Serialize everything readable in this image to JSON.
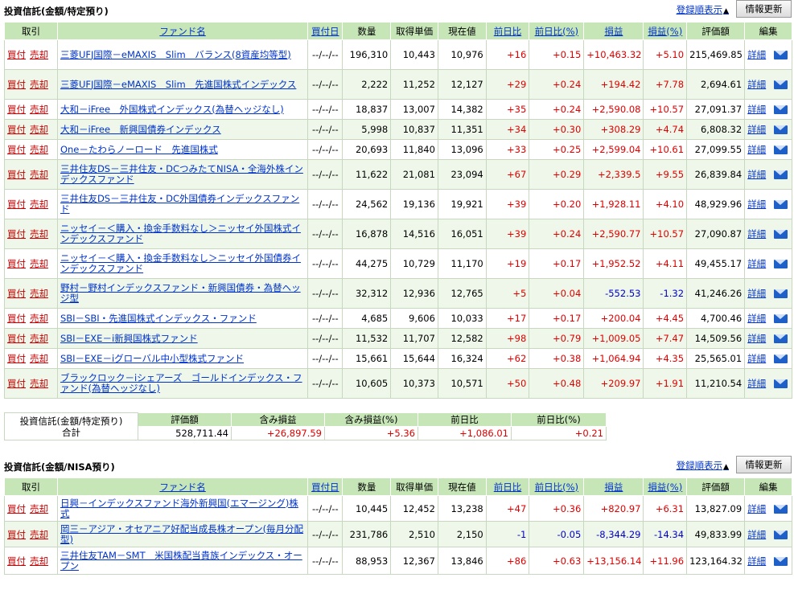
{
  "specific": {
    "title": "投資信託(金額/特定預り)",
    "order_link": "登録順表示",
    "refresh": "情報更新",
    "headers": {
      "trade": "取引",
      "fund": "ファンド名",
      "buy_date": "買付日",
      "qty": "数量",
      "cost": "取得単価",
      "price": "現在値",
      "chg": "前日比",
      "chg_pct": "前日比(%)",
      "pl": "損益",
      "pl_pct": "損益(%)",
      "value": "評価額",
      "edit": "編集"
    },
    "buy_label": "買付",
    "sell_label": "売却",
    "detail_label": "詳細",
    "rows": [
      {
        "name": "三菱UFJ国際－eMAXIS　Slim　バランス(8資産均等型)",
        "date": "--/--/--",
        "qty": "196,310",
        "cost": "10,443",
        "price": "10,976",
        "chg": "+16",
        "chg_pct": "+0.15",
        "pl": "+10,463.32",
        "pl_pct": "+5.10",
        "value": "215,469.85"
      },
      {
        "name": "三菱UFJ国際－eMAXIS　Slim　先進国株式インデックス",
        "date": "--/--/--",
        "qty": "2,222",
        "cost": "11,252",
        "price": "12,127",
        "chg": "+29",
        "chg_pct": "+0.24",
        "pl": "+194.42",
        "pl_pct": "+7.78",
        "value": "2,694.61"
      },
      {
        "name": "大和－iFree　外国株式インデックス(為替ヘッジなし)",
        "date": "--/--/--",
        "qty": "18,837",
        "cost": "13,007",
        "price": "14,382",
        "chg": "+35",
        "chg_pct": "+0.24",
        "pl": "+2,590.08",
        "pl_pct": "+10.57",
        "value": "27,091.37"
      },
      {
        "name": "大和－iFree　新興国債券インデックス",
        "date": "--/--/--",
        "qty": "5,998",
        "cost": "10,837",
        "price": "11,351",
        "chg": "+34",
        "chg_pct": "+0.30",
        "pl": "+308.29",
        "pl_pct": "+4.74",
        "value": "6,808.32"
      },
      {
        "name": "One－たわらノーロード　先進国株式",
        "date": "--/--/--",
        "qty": "20,693",
        "cost": "11,840",
        "price": "13,096",
        "chg": "+33",
        "chg_pct": "+0.25",
        "pl": "+2,599.04",
        "pl_pct": "+10.61",
        "value": "27,099.55"
      },
      {
        "name": "三井住友DS－三井住友・DCつみたてNISA・全海外株インデックスファンド",
        "date": "--/--/--",
        "qty": "11,622",
        "cost": "21,081",
        "price": "23,094",
        "chg": "+67",
        "chg_pct": "+0.29",
        "pl": "+2,339.5",
        "pl_pct": "+9.55",
        "value": "26,839.84"
      },
      {
        "name": "三井住友DS－三井住友・DC外国債券インデックスファンド",
        "date": "--/--/--",
        "qty": "24,562",
        "cost": "19,136",
        "price": "19,921",
        "chg": "+39",
        "chg_pct": "+0.20",
        "pl": "+1,928.11",
        "pl_pct": "+4.10",
        "value": "48,929.96"
      },
      {
        "name": "ニッセイ－＜購入・換金手数料なし＞ニッセイ外国株式インデックスファンド",
        "date": "--/--/--",
        "qty": "16,878",
        "cost": "14,516",
        "price": "16,051",
        "chg": "+39",
        "chg_pct": "+0.24",
        "pl": "+2,590.77",
        "pl_pct": "+10.57",
        "value": "27,090.87"
      },
      {
        "name": "ニッセイ－＜購入・換金手数料なし＞ニッセイ外国債券インデックスファンド",
        "date": "--/--/--",
        "qty": "44,275",
        "cost": "10,729",
        "price": "11,170",
        "chg": "+19",
        "chg_pct": "+0.17",
        "pl": "+1,952.52",
        "pl_pct": "+4.11",
        "value": "49,455.17"
      },
      {
        "name": "野村－野村インデックスファンド・新興国債券・為替ヘッジ型",
        "date": "--/--/--",
        "qty": "32,312",
        "cost": "12,936",
        "price": "12,765",
        "chg": "+5",
        "chg_pct": "+0.04",
        "pl": "-552.53",
        "pl_pct": "-1.32",
        "value": "41,246.26"
      },
      {
        "name": "SBI－SBI・先進国株式インデックス・ファンド",
        "date": "--/--/--",
        "qty": "4,685",
        "cost": "9,606",
        "price": "10,033",
        "chg": "+17",
        "chg_pct": "+0.17",
        "pl": "+200.04",
        "pl_pct": "+4.45",
        "value": "4,700.46"
      },
      {
        "name": "SBI－EXE－i新興国株式ファンド",
        "date": "--/--/--",
        "qty": "11,532",
        "cost": "11,707",
        "price": "12,582",
        "chg": "+98",
        "chg_pct": "+0.79",
        "pl": "+1,009.05",
        "pl_pct": "+7.47",
        "value": "14,509.56"
      },
      {
        "name": "SBI－EXE－iグローバル中小型株式ファンド",
        "date": "--/--/--",
        "qty": "15,661",
        "cost": "15,644",
        "price": "16,324",
        "chg": "+62",
        "chg_pct": "+0.38",
        "pl": "+1,064.94",
        "pl_pct": "+4.35",
        "value": "25,565.01"
      },
      {
        "name": "ブラックロック－iシェアーズ　ゴールドインデックス・ファンド(為替ヘッジなし)",
        "date": "--/--/--",
        "qty": "10,605",
        "cost": "10,373",
        "price": "10,571",
        "chg": "+50",
        "chg_pct": "+0.48",
        "pl": "+209.97",
        "pl_pct": "+1.91",
        "value": "11,210.54"
      }
    ],
    "summary": {
      "label1": "投資信託(金額/特定預り)",
      "label2": "合計",
      "headers": {
        "value": "評価額",
        "pl": "含み損益",
        "pl_pct": "含み損益(%)",
        "chg": "前日比",
        "chg_pct": "前日比(%)"
      },
      "value": "528,711.44",
      "pl": "+26,897.59",
      "pl_pct": "+5.36",
      "chg": "+1,086.01",
      "chg_pct": "+0.21"
    }
  },
  "nisa": {
    "title": "投資信託(金額/NISA預り)",
    "order_link": "登録順表示",
    "refresh": "情報更新",
    "rows": [
      {
        "name": "日興－インデックスファンド海外新興国(エマージング)株式",
        "date": "--/--/--",
        "qty": "10,445",
        "cost": "12,452",
        "price": "13,238",
        "chg": "+47",
        "chg_pct": "+0.36",
        "pl": "+820.97",
        "pl_pct": "+6.31",
        "value": "13,827.09"
      },
      {
        "name": "岡三－アジア・オセアニア好配当成長株オープン(毎月分配型)",
        "date": "--/--/--",
        "qty": "231,786",
        "cost": "2,510",
        "price": "2,150",
        "chg": "-1",
        "chg_pct": "-0.05",
        "pl": "-8,344.29",
        "pl_pct": "-14.34",
        "value": "49,833.99"
      },
      {
        "name": "三井住友TAM－SMT　米国株配当貴族インデックス・オープン",
        "date": "--/--/--",
        "qty": "88,953",
        "cost": "12,367",
        "price": "13,846",
        "chg": "+86",
        "chg_pct": "+0.63",
        "pl": "+13,156.14",
        "pl_pct": "+11.96",
        "value": "123,164.32"
      }
    ]
  },
  "colors": {
    "header_bg": "#c7e6b8",
    "row_alt": "#eef7e9",
    "positive": "#e00000",
    "negative": "#0000cc",
    "link": "#0033cc",
    "trade_link": "#cc0000"
  },
  "icons": {
    "sort": "triangle-up-icon",
    "mail": "mail-icon"
  }
}
